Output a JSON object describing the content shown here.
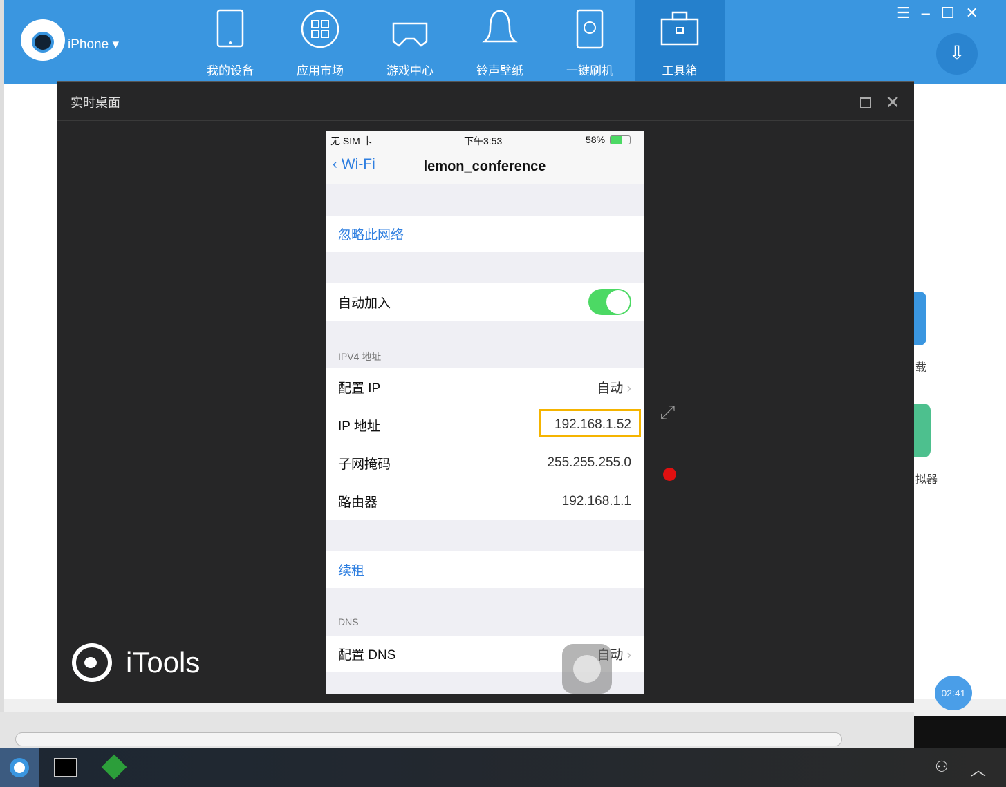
{
  "app": {
    "device_label": "iPhone ▾",
    "nav": [
      {
        "label": "我的设备",
        "icon": "tablet-icon"
      },
      {
        "label": "应用市场",
        "icon": "apps-icon"
      },
      {
        "label": "游戏中心",
        "icon": "gamepad-icon"
      },
      {
        "label": "铃声壁纸",
        "icon": "bell-icon"
      },
      {
        "label": "一键刷机",
        "icon": "flash-icon"
      },
      {
        "label": "工具箱",
        "icon": "toolbox-icon"
      }
    ],
    "active_tab": "工具箱",
    "brand_color": "#3a96e0"
  },
  "dialog": {
    "title": "实时桌面",
    "logo_text": "iTools"
  },
  "phone": {
    "status": {
      "carrier": "无 SIM 卡",
      "time": "下午3:53",
      "battery": "58%"
    },
    "back_label": "Wi-Fi",
    "title": "lemon_conference",
    "forget": "忽略此网络",
    "auto_join": {
      "label": "自动加入",
      "on": true
    },
    "ipv4_header": "IPV4 地址",
    "rows": [
      {
        "label": "配置 IP",
        "value": "自动"
      },
      {
        "label": "IP 地址",
        "value": "192.168.1.52"
      },
      {
        "label": "子网掩码",
        "value": "255.255.255.0"
      },
      {
        "label": "路由器",
        "value": "192.168.1.1"
      }
    ],
    "renew": "续租",
    "dns_header": "DNS",
    "dns_row": {
      "label": "配置 DNS",
      "value": "自动"
    }
  },
  "background": {
    "partial_labels": [
      "载",
      "拟器"
    ],
    "timer": "02:41"
  }
}
